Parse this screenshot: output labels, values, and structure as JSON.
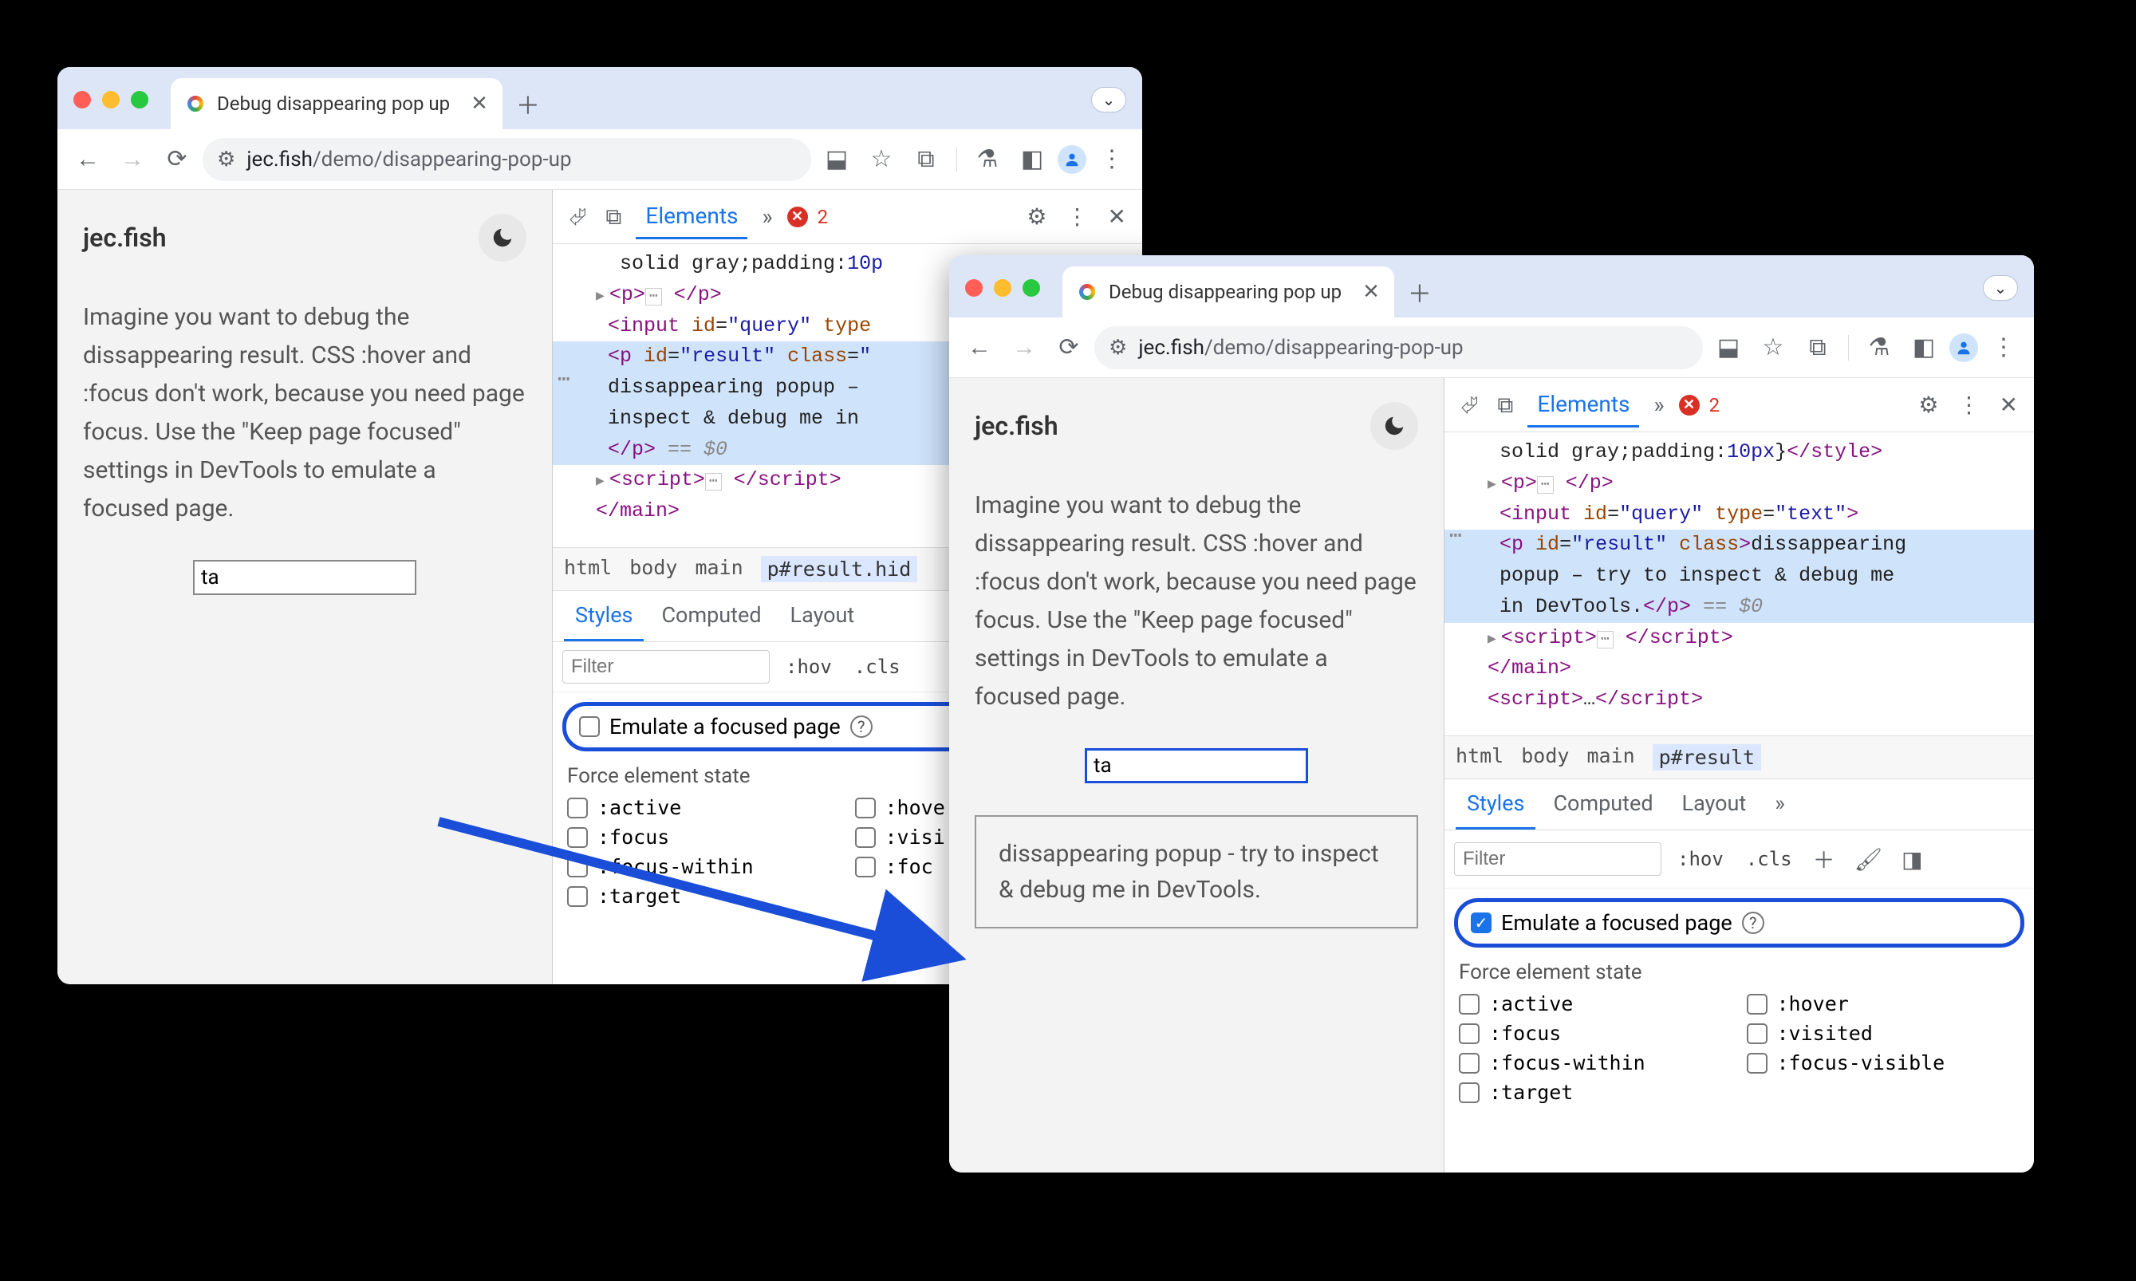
{
  "windows": {
    "left": {
      "tab_title": "Debug disappearing pop up",
      "url_domain": "jec.fish",
      "url_path": "/demo/disappearing-pop-up",
      "site_title": "jec.fish",
      "page_text": "Imagine you want to debug the dissappearing result. CSS :hover and :focus don't work, because you need page focus. Use the \"Keep page focused\" settings in DevTools to emulate a focused page.",
      "query_value": "ta",
      "devtools": {
        "top_tab": "Elements",
        "error_count": "2",
        "dom_lines": [
          "solid gray;padding:10p",
          "▶ <p>…</p>",
          "<input id=\"query\" type",
          "<p id=\"result\" class=\"",
          "dissappearing popup –",
          "inspect & debug me in",
          "</p> == $0",
          "▶<script>…</scr ipt>",
          "</main>"
        ],
        "breadcrumb": [
          "html",
          "body",
          "main",
          "p#result.hid"
        ],
        "styles_tabs": [
          "Styles",
          "Computed",
          "Layout"
        ],
        "filter_placeholder": "Filter",
        "hov": ":hov",
        "cls": ".cls",
        "emulate_label": "Emulate a focused page",
        "emulate_checked": false,
        "force_title": "Force element state",
        "force_states_left": [
          ":active",
          ":focus",
          ":focus-within",
          ":target"
        ],
        "force_states_right": [
          ":hove",
          ":visi",
          ":foc"
        ]
      }
    },
    "right": {
      "tab_title": "Debug disappearing pop up",
      "url_domain": "jec.fish",
      "url_path": "/demo/disappearing-pop-up",
      "site_title": "jec.fish",
      "page_text": "Imagine you want to debug the dissappearing result. CSS :hover and :focus don't work, because you need page focus. Use the \"Keep page focused\" settings in DevTools to emulate a focused page.",
      "query_value": "ta",
      "popup_text": "dissappearing popup - try to inspect & debug me in DevTools.",
      "devtools": {
        "top_tab": "Elements",
        "error_count": "2",
        "dom_text_pre": "solid gray;padding:10px}</style>",
        "dom_sel_line": "<p id=\"result\" class>dissappearing popup – try to inspect & debug me in DevTools.</p> == $0",
        "breadcrumb": [
          "html",
          "body",
          "main",
          "p#result"
        ],
        "styles_tabs": [
          "Styles",
          "Computed",
          "Layout"
        ],
        "filter_placeholder": "Filter",
        "hov": ":hov",
        "cls": ".cls",
        "emulate_label": "Emulate a focused page",
        "emulate_checked": true,
        "force_title": "Force element state",
        "force_states_left": [
          ":active",
          ":focus",
          ":focus-within",
          ":target"
        ],
        "force_states_right": [
          ":hover",
          ":visited",
          ":focus-visible"
        ]
      }
    }
  }
}
